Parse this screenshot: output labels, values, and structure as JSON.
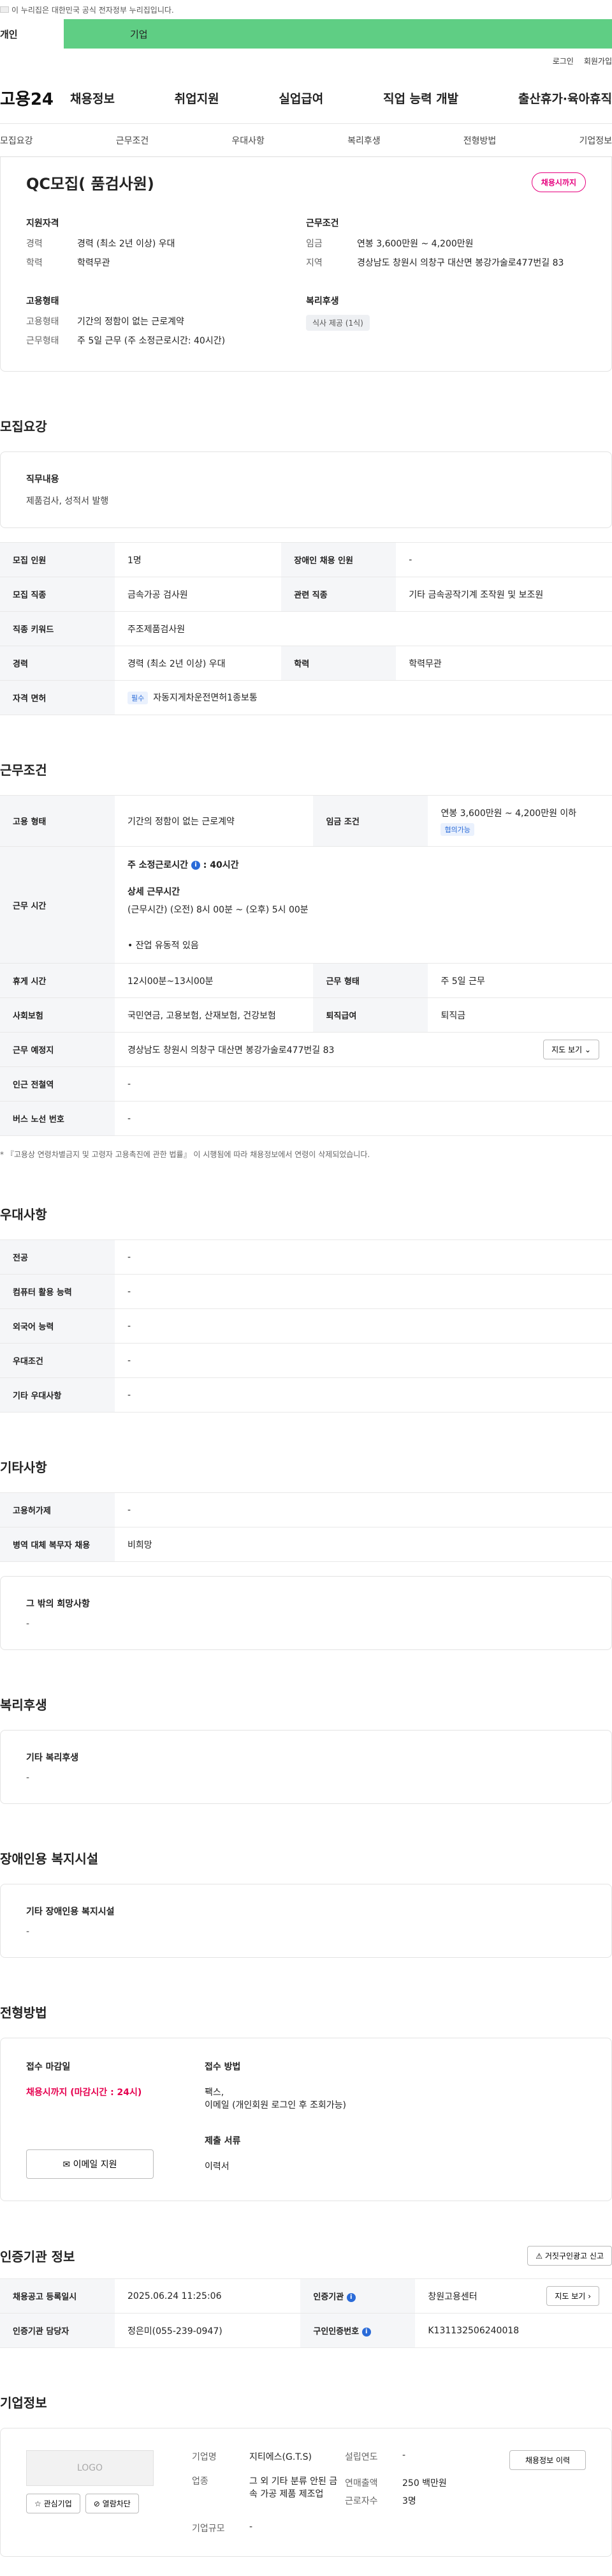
{
  "topbar": {
    "gov_notice": "이 누리집은 대한민국 공식 전자정부 누리집입니다."
  },
  "usertabs": {
    "person": "개인",
    "company": "기업"
  },
  "utility": {
    "login": "로그인",
    "signup": "회원가입"
  },
  "gnb": {
    "logo": "고용24",
    "menu": [
      "채용정보",
      "취업지원",
      "실업급여",
      "직업 능력 개발",
      "출산휴가·육아휴직"
    ]
  },
  "subtabs": [
    "모집요강",
    "근무조건",
    "우대사항",
    "복리후생",
    "전형방법",
    "기업정보"
  ],
  "summary": {
    "title": "QC모집( 품검사원)",
    "status": "채용시까지",
    "qual_heading": "지원자격",
    "qual": [
      {
        "k": "경력",
        "v": "경력 (최소 2년 이상) 우대"
      },
      {
        "k": "학력",
        "v": "학력무관"
      }
    ],
    "work_heading": "근무조건",
    "work": [
      {
        "k": "임금",
        "v": "연봉 3,600만원 ~ 4,200만원"
      },
      {
        "k": "지역",
        "v": "경상남도 창원시 의창구 대산면 봉강가술로477번길 83"
      }
    ],
    "emp_heading": "고용형태",
    "emp": [
      {
        "k": "고용형태",
        "v": "기간의 정함이 없는 근로계약"
      },
      {
        "k": "근무형태",
        "v": "주 5일 근무 (주 소정근로시간: 40시간)"
      }
    ],
    "welfare_heading": "복리후생",
    "welfare_chip": "식사 제공 (1식)"
  },
  "recruit": {
    "title": "모집요강",
    "duty_heading": "직무내용",
    "duty": "제품검사, 성적서 발행",
    "rows": [
      {
        "k1": "모집 인원",
        "v1": "1명",
        "k2": "장애인 채용 인원",
        "v2": "-"
      },
      {
        "k1": "모집 직종",
        "v1": "금속가공 검사원",
        "k2": "관련 직종",
        "v2": "기타 금속공작기계 조작원 및 보조원"
      },
      {
        "k1": "직종 키워드",
        "v1": "주조제품검사원"
      },
      {
        "k1": "경력",
        "v1": "경력 (최소 2년 이상) 우대",
        "k2": "학력",
        "v2": "학력무관"
      }
    ],
    "license_label": "자격 면허",
    "license_tag": "필수",
    "license": "자동지게차운전면허1종보통"
  },
  "conditions": {
    "title": "근무조건",
    "emp_type_label": "고용 형태",
    "emp_type": "기간의 정함이 없는 근로계약",
    "wage_label": "임금 조건",
    "wage": "연봉 3,600만원 ~ 4,200만원 이하",
    "wage_tag": "협의가능",
    "hours_label": "근무 시간",
    "hours_weekly": "주 소정근로시간",
    "hours_weekly_value": ": 40시간",
    "hours_detail_heading": "상세 근무시간",
    "hours_detail": "(근무시간) (오전) 8시 00분 ~ (오후) 5시 00분",
    "hours_note": "• 잔업 유동적 있음",
    "break_label": "휴게 시간",
    "break": "12시00분~13시00분",
    "work_form_label": "근무 형태",
    "work_form": "주 5일 근무",
    "insurance_label": "사회보험",
    "insurance": "국민연금, 고용보험, 산재보험, 건강보험",
    "severance_label": "퇴직급여",
    "severance": "퇴직금",
    "place_label": "근무 예정지",
    "place": "경상남도 창원시 의창구 대산면 봉강가술로477번길 83",
    "map_button": "지도 보기",
    "station_label": "인근 전철역",
    "station": "-",
    "bus_label": "버스 노선 번호",
    "bus": "-",
    "note": "* 『고용상 연령차별금지 및 고령자 고용촉진에 관한 법률』 이 시행됨에 따라 채용정보에서 연령이 삭제되었습니다."
  },
  "preference": {
    "title": "우대사항",
    "rows": [
      {
        "k": "전공",
        "v": "-"
      },
      {
        "k": "컴퓨터 활용 능력",
        "v": "-"
      },
      {
        "k": "외국어 능력",
        "v": "-"
      },
      {
        "k": "우대조건",
        "v": "-"
      },
      {
        "k": "기타 우대사항",
        "v": "-"
      }
    ]
  },
  "etc": {
    "title": "기타사항",
    "rows": [
      {
        "k": "고용허가제",
        "v": "-"
      },
      {
        "k": "병역 대체 복무자 채용",
        "v": "비희망"
      }
    ],
    "other_heading": "그 밖의 희망사항",
    "other": "-"
  },
  "welfare": {
    "title": "복리후생",
    "heading": "기타 복리후생",
    "value": "-"
  },
  "disability": {
    "title": "장애인용 복지시설",
    "heading": "기타 장애인용 복지시설",
    "value": "-"
  },
  "apply": {
    "title": "전형방법",
    "deadline_heading": "접수 마감일",
    "deadline": "채용시까지 (마감시간 : 24시)",
    "email_button": "이메일 지원",
    "method_heading": "접수 방법",
    "method": "팩스,",
    "method2": "이메일 (개인회원 로그인 후 조회가능)",
    "docs_heading": "제출 서류",
    "docs": "이력서"
  },
  "agency": {
    "title": "인증기관 정보",
    "report_button": "거짓구인광고 신고",
    "reg_label": "채용공고 등록일시",
    "reg": "2025.06.24 11:25:06",
    "org_label": "인증기관",
    "org": "창원고용센터",
    "map_button": "지도 보기",
    "manager_label": "인증기관 담당자",
    "manager": "정은미(055-239-0947)",
    "id_label": "구인인증번호",
    "id": "K131132506240018"
  },
  "company": {
    "title": "기업정보",
    "logo": "LOGO",
    "fav_button": "관심기업",
    "block_button": "열람차단",
    "name_label": "기업명",
    "name": "지티에스(G.T.S)",
    "founded_label": "설립연도",
    "founded": "-",
    "industry_label": "업종",
    "industry": "그 외 기타 분류 안된 금속 가공 제품 제조업",
    "sales_label": "연매출액",
    "sales": "250 백만원",
    "staff_label": "근로자수",
    "staff": "3명",
    "size_label": "기업규모",
    "size": "-",
    "jobs_button": "채용정보 이력"
  }
}
